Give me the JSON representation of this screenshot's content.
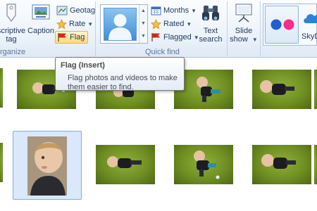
{
  "ribbon": {
    "organize": {
      "group_label": "rganize",
      "descriptive_tag_line1": "scriptive",
      "descriptive_tag_line2": "tag",
      "caption_label": "Caption",
      "geotag_label": "Geotag",
      "rate_label": "Rate",
      "flag_label": "Flag"
    },
    "quick_find": {
      "group_label": "Quick find",
      "months_label": "Months",
      "rated_label": "Rated",
      "flagged_label": "Flagged",
      "text_search_line1": "Text",
      "text_search_line2": "search",
      "slide_show_line1": "Slide",
      "slide_show_line2": "show"
    },
    "share": {
      "skydrive_label": "SkyD"
    }
  },
  "tooltip": {
    "title": "Flag (Insert)",
    "body_line1": "Flag photos and videos to make",
    "body_line2": "them easier to find."
  },
  "colors": {
    "ribbon_background": "#eef4fb",
    "selected_tile": "#d9e9fb",
    "flag_highlight": "#ffd97a",
    "flickr_blue": "#1f5fd6",
    "flickr_pink": "#ff2a8c"
  },
  "icons": {
    "descriptive_tag": "tag-icon",
    "caption": "caption-icon",
    "geotag": "geotag-icon",
    "rate": "star-icon",
    "flag": "flag-icon",
    "months": "calendar-icon",
    "rated": "star-icon",
    "flagged": "flag-icon",
    "text_search": "binoculars-icon",
    "slide_show": "projector-icon",
    "flickr": "flickr-icon",
    "skydrive": "cloud-icon",
    "people": "person-icon"
  }
}
